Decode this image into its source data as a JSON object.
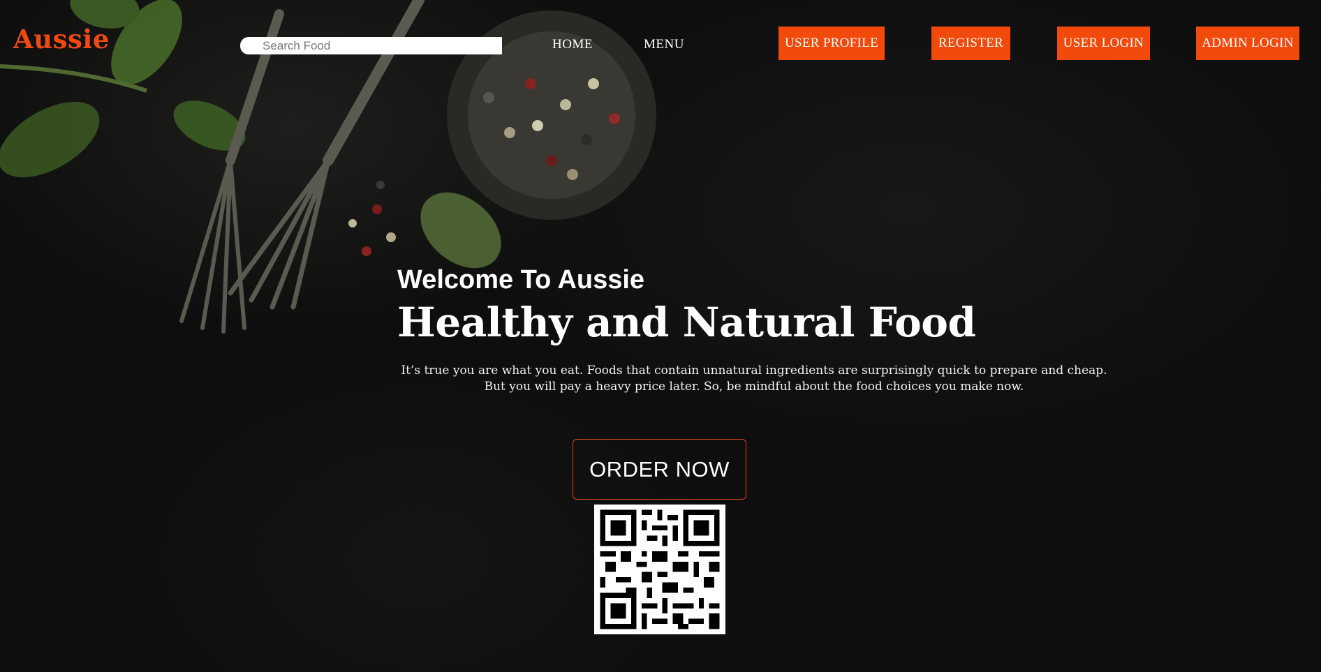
{
  "brand": {
    "logo": "Aussie",
    "accent_color": "#f24a0b"
  },
  "search": {
    "placeholder": "Search Food",
    "value": ""
  },
  "nav": {
    "home": "HOME",
    "menu": "MENU",
    "user_profile": "USER PROFILE",
    "register": "REGISTER",
    "user_login": "USER LOGIN",
    "admin_login": "ADMIN LOGIN"
  },
  "hero": {
    "welcome": "Welcome To Aussie",
    "headline": "Healthy and Natural Food",
    "description_line1": "It’s true you are what you eat. Foods that contain unnatural ingredients are surprisingly quick to prepare and cheap.",
    "description_line2": "But you will pay a heavy price later. So, be mindful about the food choices you make now.",
    "order_button": "ORDER NOW"
  },
  "qr_code": {
    "icon": "qr-code-icon"
  },
  "background": {
    "icon": "food-table-background-image"
  }
}
